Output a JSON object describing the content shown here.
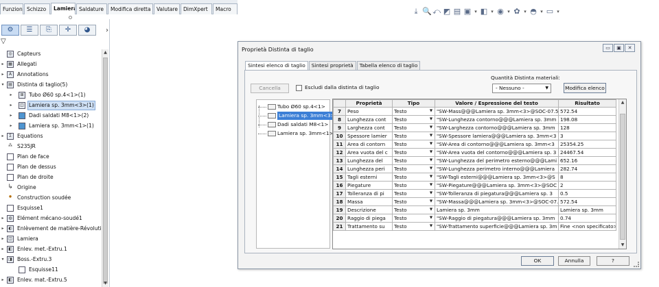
{
  "tabs": [
    "Funzioni",
    "Schizzo",
    "Lamiera",
    "Saldature",
    "Modifica diretta",
    "Valutare",
    "DimXpert",
    "Macro"
  ],
  "active_tab": "Lamiera",
  "tree": [
    {
      "label": "Capteurs",
      "icon": "sensor-icon"
    },
    {
      "label": "Allegati",
      "icon": "attachments-icon"
    },
    {
      "label": "Annotations",
      "icon": "annotations-icon"
    },
    {
      "label": "Distinta di taglio(5)",
      "icon": "cutlist-icon"
    },
    {
      "label": "Tubo Ø60 sp.4<1>(1)",
      "icon": "weldment-icon"
    },
    {
      "label": "Lamiera sp. 3mm<3>(1)",
      "icon": "sheetmetal-icon"
    },
    {
      "label": "Dadi saldati M8<1>(2)",
      "icon": "body-icon"
    },
    {
      "label": "Lamiera sp. 3mm<1>(1)",
      "icon": "body-icon"
    },
    {
      "label": "Equations",
      "icon": "equations-icon"
    },
    {
      "label": "S235JR",
      "icon": "material-icon"
    },
    {
      "label": "Plan de face",
      "icon": "plane-icon"
    },
    {
      "label": "Plan de dessus",
      "icon": "plane-icon"
    },
    {
      "label": "Plan de droite",
      "icon": "plane-icon"
    },
    {
      "label": "Origine",
      "icon": "origin-icon"
    },
    {
      "label": "Construction soudée",
      "icon": "weld-icon"
    },
    {
      "label": "Esquisse1",
      "icon": "sketch-icon"
    },
    {
      "label": "Elément mécano-soudé1",
      "icon": "feature-icon"
    },
    {
      "label": "Enlèvement de matière-Révolutio",
      "icon": "revolve-cut-icon"
    },
    {
      "label": "Lamiera",
      "icon": "sheetmetal-icon"
    },
    {
      "label": "Enlev. met.-Extru.1",
      "icon": "extrude-cut-icon"
    },
    {
      "label": "Boss.-Extru.3",
      "icon": "extrude-icon"
    },
    {
      "label": "Esquisse11",
      "icon": "sketch-icon"
    },
    {
      "label": "Enlev. mat.-Extru.5",
      "icon": "extrude-cut-icon"
    }
  ],
  "dialog": {
    "title": "Proprietà Distinta di taglio",
    "tabs": [
      "Sintesi elenco di taglio",
      "Sintesi proprietà",
      "Tabella elenco di taglio"
    ],
    "cancel_label": "Cancella",
    "exclude_label": "Escludi dalla distinta di taglio",
    "quantity_label": "Quantità Distinta materiali:",
    "quantity_value": "- Nessuno -",
    "edit_list_label": "Modifica elenco",
    "bodies": [
      "Tubo Ø60 sp.4<1>",
      "Lamiera sp. 3mm<3>",
      "Dadi saldati M8<1>",
      "Lamiera sp. 3mm<1>"
    ],
    "columns": [
      "Proprietà",
      "Tipo",
      "Valore / Espressione del testo",
      "Risultato"
    ],
    "rows": [
      {
        "n": "7",
        "prop": "Peso",
        "tipo": "Testo",
        "valore": "\"SW-Mass@@@Lamiera sp. 3mm<3>@SOC-07.5",
        "risultato": "572.54"
      },
      {
        "n": "8",
        "prop": "Lunghezza cont",
        "tipo": "Testo",
        "valore": "\"SW-Lunghezza contorno@@@Lamiera sp. 3mm",
        "risultato": "198.08"
      },
      {
        "n": "9",
        "prop": "Larghezza cont",
        "tipo": "Testo",
        "valore": "\"SW-Larghezza contorno@@@Lamiera sp. 3mm",
        "risultato": "128"
      },
      {
        "n": "10",
        "prop": "Spessore lamier",
        "tipo": "Testo",
        "valore": "\"SW-Spessore lamiera@@@Lamiera sp. 3mm<3",
        "risultato": "3"
      },
      {
        "n": "11",
        "prop": "Area di contorn",
        "tipo": "Testo",
        "valore": "\"SW-Area di contorno@@@Lamiera sp. 3mm<3",
        "risultato": "25354.25"
      },
      {
        "n": "12",
        "prop": "Area vuota del c",
        "tipo": "Testo",
        "valore": "\"SW-Area vuota del contorno@@@Lamiera sp. 3",
        "risultato": "24467.54"
      },
      {
        "n": "13",
        "prop": "Lunghezza del",
        "tipo": "Testo",
        "valore": "\"SW-Lunghezza del perimetro esterno@@@Lami",
        "risultato": "652.16"
      },
      {
        "n": "14",
        "prop": "Lunghezza peri",
        "tipo": "Testo",
        "valore": "\"SW-Lunghezza perimetro interno@@@Lamiera",
        "risultato": "282.74"
      },
      {
        "n": "15",
        "prop": "Tagli esterni",
        "tipo": "Testo",
        "valore": "\"SW-Tagli esterni@@@Lamiera sp. 3mm<3>@S",
        "risultato": "8"
      },
      {
        "n": "16",
        "prop": "Piegature",
        "tipo": "Testo",
        "valore": "\"SW-Piegature@@@Lamiera sp. 3mm<3>@SOC",
        "risultato": "2"
      },
      {
        "n": "17",
        "prop": "Tolleranza di pi",
        "tipo": "Testo",
        "valore": "\"SW-Tolleranza di piegatura@@@Lamiera sp. 3",
        "risultato": "0.5"
      },
      {
        "n": "18",
        "prop": "Massa",
        "tipo": "Testo",
        "valore": "\"SW-Massa@@@Lamiera sp. 3mm<3>@SOC-07.",
        "risultato": "572.54"
      },
      {
        "n": "19",
        "prop": "Descrizione",
        "tipo": "Testo",
        "valore": "Lamiera sp. 3mm",
        "risultato": "Lamiera sp. 3mm"
      },
      {
        "n": "20",
        "prop": "Raggio di piega",
        "tipo": "Testo",
        "valore": "\"SW-Raggio di piegatura@@@Lamiera sp. 3mm",
        "risultato": "0.74"
      },
      {
        "n": "21",
        "prop": "Trattamento su",
        "tipo": "Testo",
        "valore": "\"SW-Trattamento superficie@@@Lamiera sp. 3m",
        "risultato": "Fine <non specificato>"
      }
    ],
    "ok_label": "OK",
    "annulla_label": "Annulla",
    "help_label": "?"
  }
}
